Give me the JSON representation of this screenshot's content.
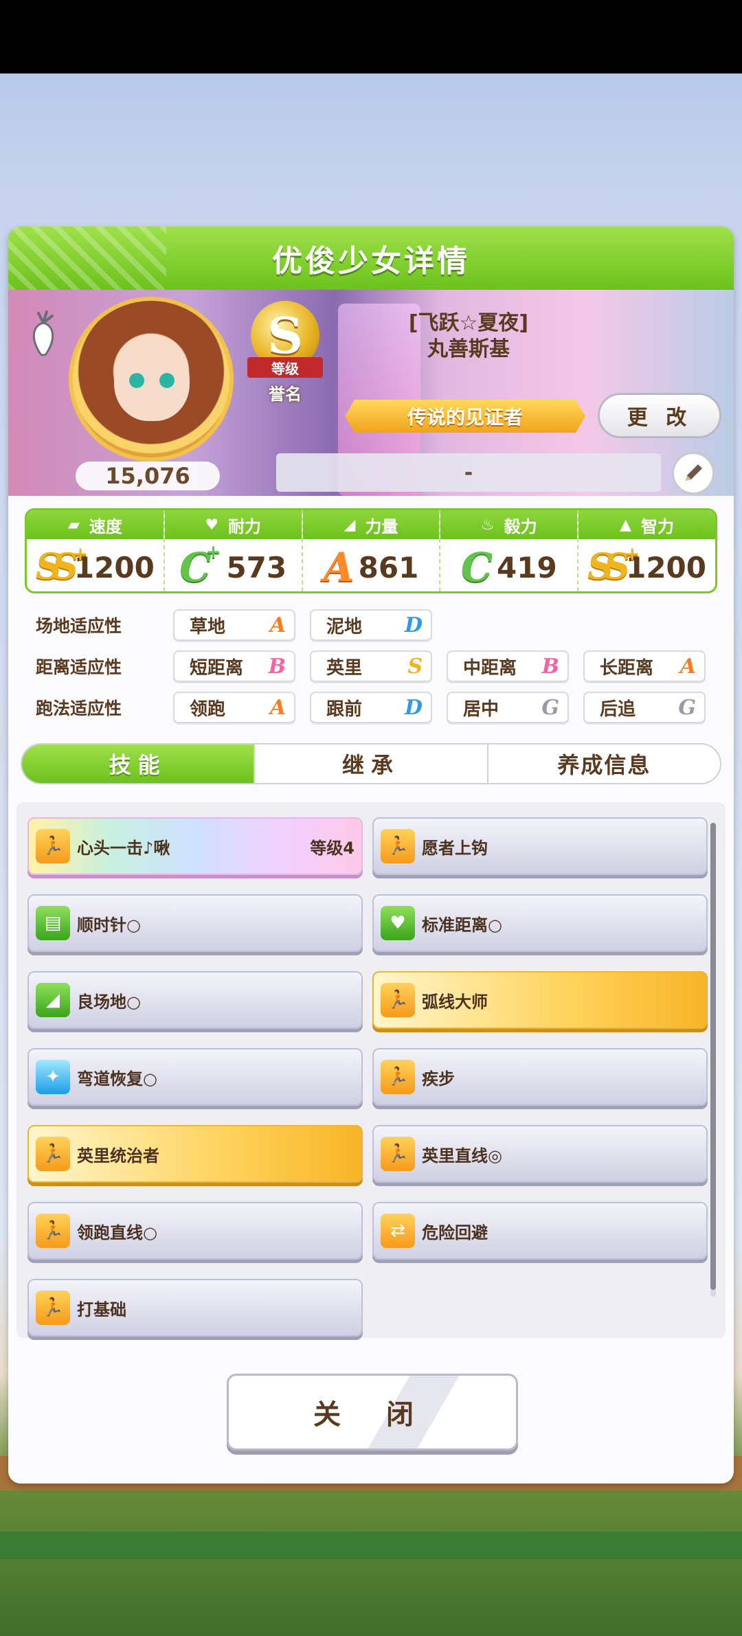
{
  "header": {
    "title": "优俊少女详情"
  },
  "profile": {
    "fans": "15,076",
    "rank_letter": "S",
    "rank_label": "等级",
    "rank_name": "誉名",
    "outfit": "[飞跃☆夏夜]",
    "name": "丸善斯基",
    "epithet": "传说的见证者",
    "change_label": "更 改",
    "comment": "-"
  },
  "stats": [
    {
      "label": "速度",
      "icon": "shoe-icon",
      "grade": "SS",
      "plus": "+",
      "value": "1200"
    },
    {
      "label": "耐力",
      "icon": "heart-icon",
      "grade": "C",
      "plus": "+",
      "value": "573"
    },
    {
      "label": "力量",
      "icon": "muscle-icon",
      "grade": "A",
      "plus": "",
      "value": "861"
    },
    {
      "label": "毅力",
      "icon": "flame-icon",
      "grade": "C",
      "plus": "",
      "value": "419"
    },
    {
      "label": "智力",
      "icon": "graduation-cap-icon",
      "grade": "SS",
      "plus": "+",
      "value": "1200"
    }
  ],
  "aptitude": {
    "track": {
      "label": "场地适应性",
      "items": [
        {
          "name": "草地",
          "grade": "A"
        },
        {
          "name": "泥地",
          "grade": "D"
        }
      ]
    },
    "distance": {
      "label": "距离适应性",
      "items": [
        {
          "name": "短距离",
          "grade": "B"
        },
        {
          "name": "英里",
          "grade": "S"
        },
        {
          "name": "中距离",
          "grade": "B"
        },
        {
          "name": "长距离",
          "grade": "A"
        }
      ]
    },
    "style": {
      "label": "跑法适应性",
      "items": [
        {
          "name": "领跑",
          "grade": "A"
        },
        {
          "name": "跟前",
          "grade": "D"
        },
        {
          "name": "居中",
          "grade": "G"
        },
        {
          "name": "后追",
          "grade": "G"
        }
      ]
    }
  },
  "grade_colors": {
    "A": "#ff7a1a",
    "B": "#ff5fa2",
    "D": "#2f9be8",
    "G": "#9a9aa6",
    "S": "#f0b41c"
  },
  "tabs": [
    {
      "label": "技能"
    },
    {
      "label": "继承"
    },
    {
      "label": "养成信息"
    }
  ],
  "skills": [
    {
      "name": "心头一击♪啾",
      "level": "等级4",
      "style": "rainbow",
      "icon": "runner-icon"
    },
    {
      "name": "愿者上钩",
      "level": "",
      "style": "normal",
      "icon": "runner-icon"
    },
    {
      "name": "顺时针○",
      "level": "",
      "style": "normal",
      "icon": "green-card-icon"
    },
    {
      "name": "标准距离○",
      "level": "",
      "style": "normal",
      "icon": "green-heart-icon"
    },
    {
      "name": "良场地○",
      "level": "",
      "style": "normal",
      "icon": "green-muscle-icon"
    },
    {
      "name": "弧线大师",
      "level": "",
      "style": "gold",
      "icon": "runner-icon"
    },
    {
      "name": "弯道恢复○",
      "level": "",
      "style": "normal",
      "icon": "sparkle-icon"
    },
    {
      "name": "疾步",
      "level": "",
      "style": "normal",
      "icon": "runner-icon"
    },
    {
      "name": "英里统治者",
      "level": "",
      "style": "gold",
      "icon": "runner-icon"
    },
    {
      "name": "英里直线◎",
      "level": "",
      "style": "normal",
      "icon": "runner-icon"
    },
    {
      "name": "领跑直线○",
      "level": "",
      "style": "normal",
      "icon": "runner-icon"
    },
    {
      "name": "危险回避",
      "level": "",
      "style": "normal",
      "icon": "swap-arrows-icon"
    },
    {
      "name": "打基础",
      "level": "",
      "style": "normal",
      "icon": "runner-icon"
    }
  ],
  "close_label": "关 闭"
}
